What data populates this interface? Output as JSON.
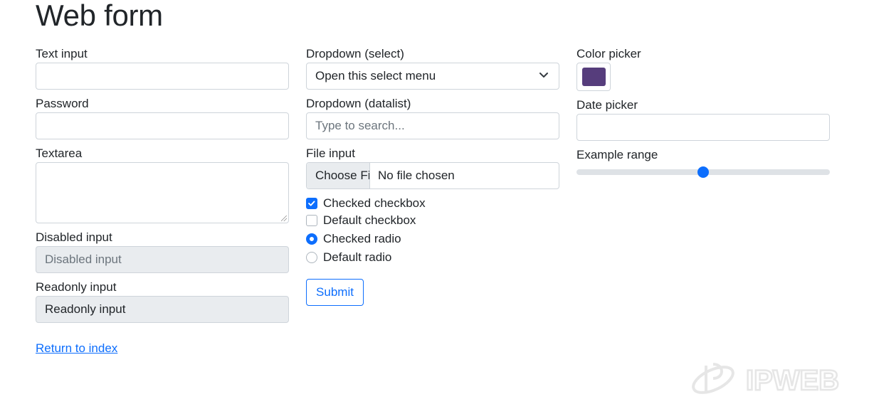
{
  "page": {
    "title": "Web form"
  },
  "col1": {
    "text_input_label": "Text input",
    "text_input_value": "",
    "password_label": "Password",
    "password_value": "",
    "textarea_label": "Textarea",
    "textarea_value": "",
    "disabled_label": "Disabled input",
    "disabled_value": "Disabled input",
    "readonly_label": "Readonly input",
    "readonly_value": "Readonly input"
  },
  "col2": {
    "select_label": "Dropdown (select)",
    "select_value": "Open this select menu",
    "datalist_label": "Dropdown (datalist)",
    "datalist_placeholder": "Type to search...",
    "file_label": "File input",
    "file_button": "Choose File",
    "file_status": "No file chosen",
    "checked_checkbox": "Checked checkbox",
    "default_checkbox": "Default checkbox",
    "checked_radio": "Checked radio",
    "default_radio": "Default radio",
    "submit": "Submit"
  },
  "col3": {
    "color_label": "Color picker",
    "color_value": "#563d7c",
    "date_label": "Date picker",
    "date_value": "",
    "range_label": "Example range",
    "range_fraction": 0.5
  },
  "footer": {
    "return_link": "Return to index"
  },
  "watermark": {
    "text": "IPWEB"
  },
  "colors": {
    "accent": "#0d6efd",
    "border": "#ced4da",
    "disabled_bg": "#e9ecef",
    "muted_text": "#6c757d"
  }
}
